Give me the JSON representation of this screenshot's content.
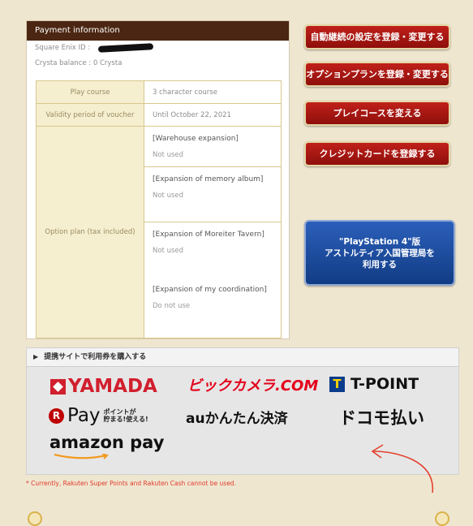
{
  "payment": {
    "header": "Payment information",
    "sqex_id_label": "Square Enix ID : ",
    "crysta_balance": "Crysta balance : 0 Crysta",
    "rows": {
      "play_course_label": "Play course",
      "play_course_value": "3 character course",
      "validity_label": "Validity period of voucher",
      "validity_value": "Until October 22, 2021",
      "option_label": "Option plan (tax included)"
    },
    "options": [
      {
        "title": "[Warehouse expansion]",
        "status": "Not used"
      },
      {
        "title": "[Expansion of memory album]",
        "status": "Not used"
      },
      {
        "title": "[Expansion of Moreiter Tavern]",
        "status": "Not used"
      },
      {
        "title": "[Expansion of my coordination]",
        "status": "Do not use"
      }
    ]
  },
  "buttons": {
    "auto_renew": "自動継続の設定を登録・変更する",
    "option_plan": "オプションプランを登録・変更する",
    "play_course": "プレイコースを変える",
    "credit_card": "クレジットカードを登録する",
    "ps4": "\"PlayStation 4\"版\nアストルティア入国管理局を\n利用する"
  },
  "partner": {
    "heading": "提携サイトで利用券を購入する",
    "logos": {
      "yamada": "YAMADA",
      "bic": "ビックカメラ.COM",
      "tpoint": "T-POINT",
      "tpoint_mark": "T",
      "rpay_mark": "R",
      "rpay": "Pay",
      "rpay_sub": "ポイントが\n貯まる!使える!",
      "au": "auかんたん決済",
      "docomo": "ドコモ払い",
      "amazon": "amazon pay"
    }
  },
  "note": "* Currently, Rakuten Super Points and Rakuten Cash cannot be used.",
  "colors": {
    "background": "#efe6d0",
    "header_brown": "#4b2612",
    "red_button": "#a8170f",
    "ps4_blue": "#1f4fa3",
    "note_red": "#e03a2a"
  },
  "icons": {
    "partner_triangle": "triangle-right-icon",
    "annotation_arrow": "hand-drawn-arrow-icon"
  }
}
